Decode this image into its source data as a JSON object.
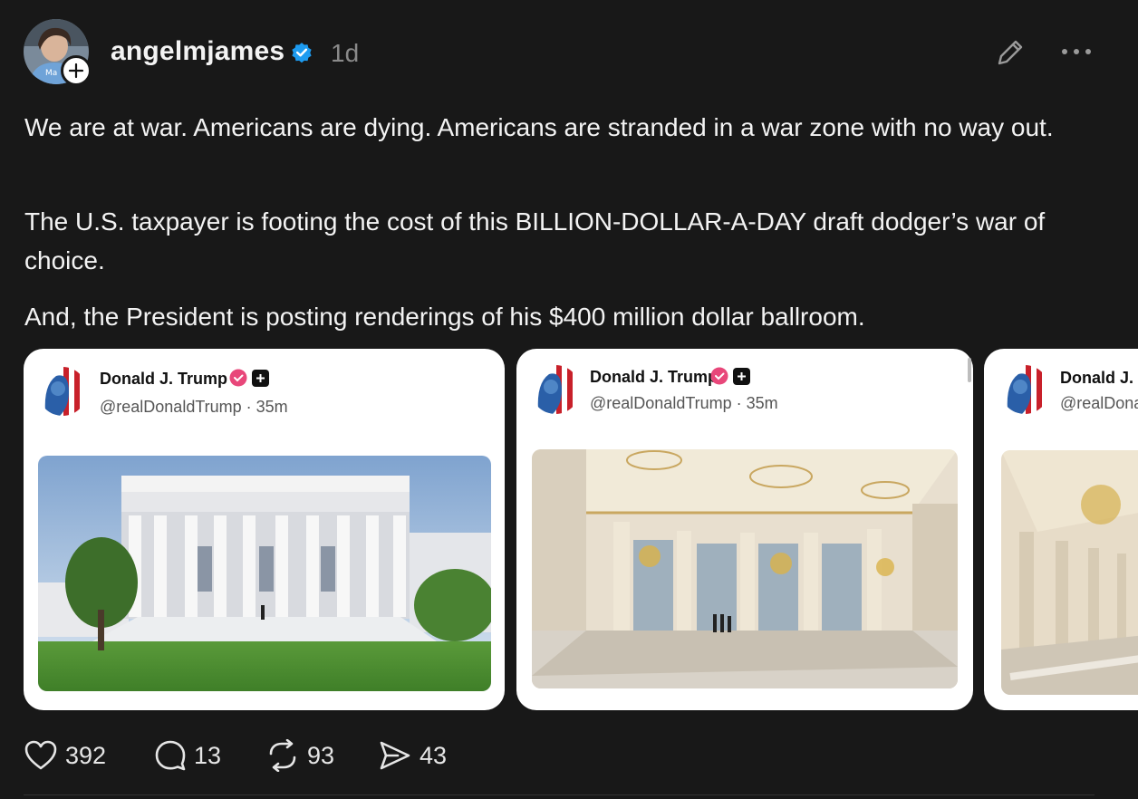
{
  "post": {
    "username": "angelmjames",
    "timestamp": "1d",
    "paragraphs": [
      "We are at war. Americans are dying. Americans are stranded in a war zone with no way out.",
      "The U.S. taxpayer is footing the cost of this BILLION-DOLLAR-A-DAY draft dodger’s war of choice.",
      "And, the President is posting renderings of his $400 million dollar ballroom."
    ]
  },
  "cards": [
    {
      "name": "Donald J. Trump",
      "handle": "@realDonaldTrump · 35m",
      "image": "white-house-ballroom-exterior-rendering"
    },
    {
      "name": "Donald J. Trump",
      "handle": "@realDonaldTrump · 35m",
      "image": "ballroom-interior-rendering"
    },
    {
      "name": "Donald J. T",
      "handle": "@realDona",
      "image": "ballroom-interior-rendering-2"
    }
  ],
  "actions": {
    "likes": "392",
    "replies": "13",
    "reposts": "93",
    "shares": "43"
  },
  "icons": {
    "verified": "verified-badge-icon",
    "edit": "pencil-icon",
    "more": "more-dots-icon",
    "like": "heart-icon",
    "reply": "comment-icon",
    "repost": "repost-icon",
    "share": "send-icon"
  },
  "colors": {
    "background": "#181818",
    "verified_blue": "#1d9bf0",
    "truth_badge_pink": "#e8477a",
    "muted_text": "#8a8a8a"
  }
}
